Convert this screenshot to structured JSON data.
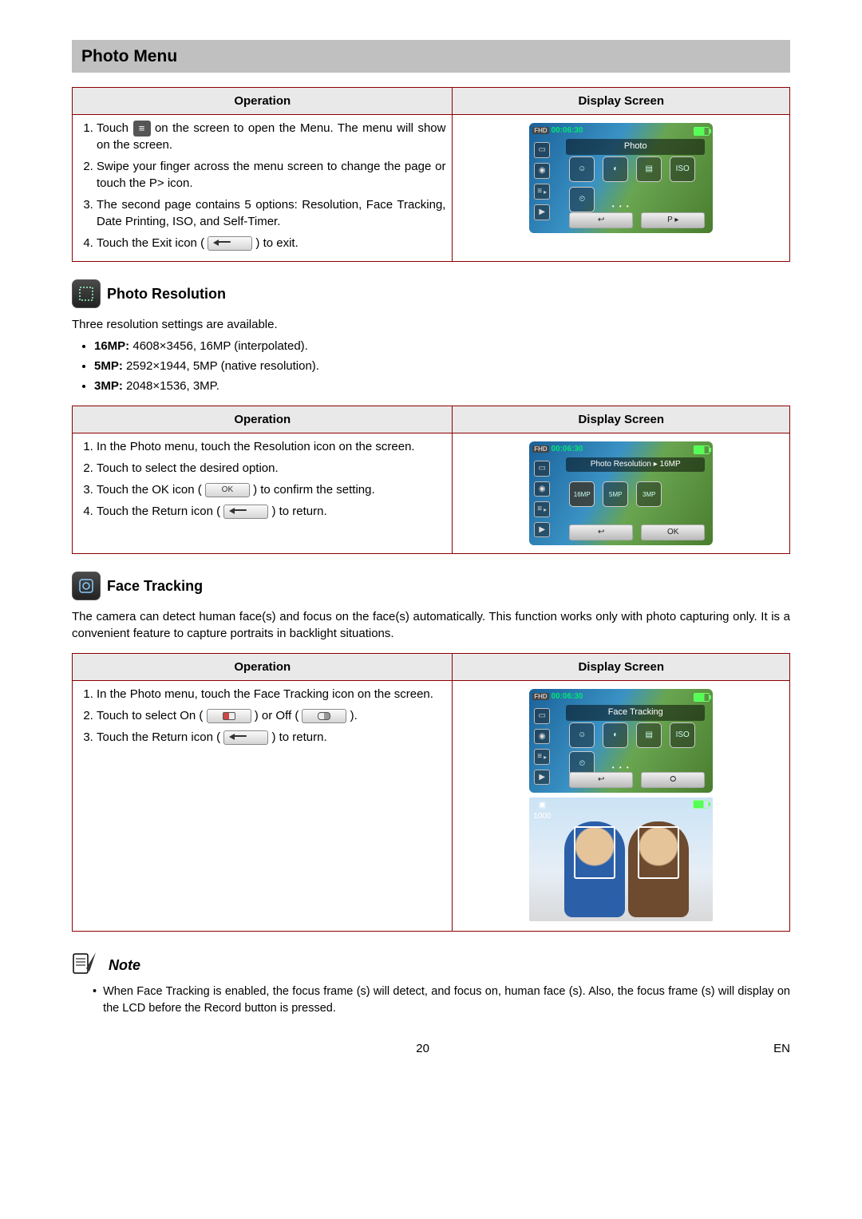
{
  "page": {
    "title": "Photo Menu",
    "number": "20",
    "lang": "EN"
  },
  "headers": {
    "operation": "Operation",
    "display": "Display Screen"
  },
  "icons": {
    "menu": "≡",
    "ok": "OK",
    "return": "↩",
    "on_switch": "ON",
    "off_switch": "OFF"
  },
  "photo_menu": {
    "steps": {
      "s1a": "Touch ",
      "s1b": " on the screen to open the Menu. The menu will show on the screen.",
      "s2": "Swipe your finger across the menu screen to change the page or touch the P> icon.",
      "s3": "The second page contains 5 options: Resolution, Face Tracking, Date Printing, ISO, and Self-Timer.",
      "s4a": "Touch the Exit icon ( ",
      "s4b": " ) to exit."
    },
    "screen": {
      "time": "00:06:30",
      "mode_badge": "FHD",
      "title": "Photo",
      "icons": {
        "smile": "☺",
        "face": "◐",
        "date": "▤",
        "iso": "ISO",
        "timer": "⏲"
      },
      "page_btn": "P ▸"
    }
  },
  "photo_res": {
    "heading": "Photo Resolution",
    "intro": "Three resolution settings are available.",
    "bullets": {
      "b1_label": "16MP:",
      "b1_val": " 4608×3456, 16MP (interpolated).",
      "b2_label": "5MP:",
      "b2_val": " 2592×1944, 5MP (native resolution).",
      "b3_label": "3MP:",
      "b3_val": " 2048×1536, 3MP."
    },
    "steps": {
      "s1": "In the Photo menu, touch the Resolution icon on the screen.",
      "s2": "Touch to select the desired option.",
      "s3a": "Touch the OK icon ( ",
      "s3b": " ) to confirm the setting.",
      "s4a": "Touch the Return icon ( ",
      "s4b": " ) to return."
    },
    "screen": {
      "time": "00:06:30",
      "title": "Photo Resolution ▸ 16MP",
      "opts": {
        "a": "16MP",
        "b": "5MP",
        "c": "3MP"
      },
      "ok": "OK"
    }
  },
  "face_track": {
    "heading": "Face Tracking",
    "intro": "The camera can detect human face(s) and focus on the face(s) automatically. This function works only with photo capturing only. It is a convenient feature to capture portraits in backlight situations.",
    "steps": {
      "s1": "In the Photo menu, touch the Face Tracking  icon on the screen.",
      "s2a": "Touch to select On  ( ",
      "s2b": " ) or Off  ( ",
      "s2c": " ).",
      "s3a": "Touch the Return icon ( ",
      "s3b": " ) to return."
    },
    "screen": {
      "time": "00:06:30",
      "title": "Face Tracking",
      "sample_count": "1000"
    }
  },
  "note": {
    "heading": "Note",
    "text": "When Face Tracking is enabled, the focus frame (s) will detect, and focus on, human face (s). Also, the focus frame (s) will display on the LCD before the Record  button is pressed."
  }
}
